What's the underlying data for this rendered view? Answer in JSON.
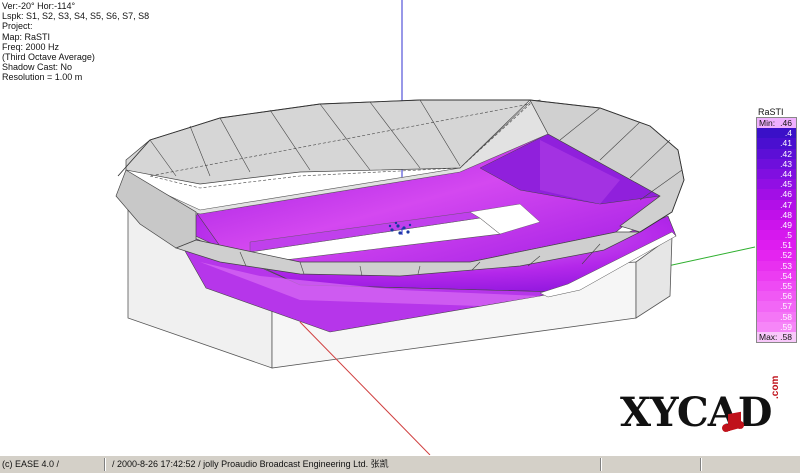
{
  "info": {
    "lines": [
      "Ver:-20°  Hor:-114°",
      "Lspk: S1, S2, S3, S4, S5, S6, S7, S8",
      "Project:",
      "Map: RaSTI",
      "Freq: 2000 Hz",
      "(Third Octave Average)",
      "Shadow Cast: No",
      "Resolution =  1.00 m"
    ]
  },
  "legend": {
    "title": "RaSTI",
    "rows": [
      {
        "label": "Min:",
        "value": ".46",
        "color": "#f0b0ff",
        "text_color": "#111111"
      },
      {
        "label": "",
        "value": ".4",
        "color": "#3a10c8",
        "text_color": "#ffffff"
      },
      {
        "label": "",
        "value": ".41",
        "color": "#4a0fd0",
        "text_color": "#ffffff"
      },
      {
        "label": "",
        "value": ".42",
        "color": "#5c0fd6",
        "text_color": "#ffffff"
      },
      {
        "label": "",
        "value": ".43",
        "color": "#6e0fdc",
        "text_color": "#ffffff"
      },
      {
        "label": "",
        "value": ".44",
        "color": "#800fe0",
        "text_color": "#ffffff"
      },
      {
        "label": "",
        "value": ".45",
        "color": "#910fe4",
        "text_color": "#ffffff"
      },
      {
        "label": "",
        "value": ".46",
        "color": "#a20fe6",
        "text_color": "#ffffff"
      },
      {
        "label": "",
        "value": ".47",
        "color": "#b20fe8",
        "text_color": "#ffffff"
      },
      {
        "label": "",
        "value": ".48",
        "color": "#c010ea",
        "text_color": "#ffffff"
      },
      {
        "label": "",
        "value": ".49",
        "color": "#cc14ec",
        "text_color": "#ffffff"
      },
      {
        "label": "",
        "value": ".5",
        "color": "#d618ee",
        "text_color": "#ffffff"
      },
      {
        "label": "",
        "value": ".51",
        "color": "#de1cf0",
        "text_color": "#ffffff"
      },
      {
        "label": "",
        "value": ".52",
        "color": "#e424f0",
        "text_color": "#ffffff"
      },
      {
        "label": "",
        "value": ".53",
        "color": "#e830f0",
        "text_color": "#ffffff"
      },
      {
        "label": "",
        "value": ".54",
        "color": "#ec3cf2",
        "text_color": "#ffffff"
      },
      {
        "label": "",
        "value": ".55",
        "color": "#ee4af4",
        "text_color": "#ffffff"
      },
      {
        "label": "",
        "value": ".56",
        "color": "#f058f4",
        "text_color": "#ffffff"
      },
      {
        "label": "",
        "value": ".57",
        "color": "#f266f6",
        "text_color": "#ffffff"
      },
      {
        "label": "",
        "value": ".58",
        "color": "#f476f6",
        "text_color": "#ffffff"
      },
      {
        "label": "",
        "value": ".59",
        "color": "#f686f8",
        "text_color": "#ffffff"
      },
      {
        "label": "Max:",
        "value": ".58",
        "color": "#f8c8fa",
        "text_color": "#111111"
      }
    ]
  },
  "logo": {
    "text": "XYCAD",
    "sub": ".com"
  },
  "statusbar": {
    "cells": [
      "(c) EASE 4.0  /",
      "/ 2000-8-26 17:42:52 / jolly Proaudio Broadcast Engineering Ltd. 张凯"
    ]
  },
  "colors": {
    "floor": "#b020e8",
    "floor_light": "#e070f0",
    "roof": "#d8d8d8",
    "wall": "#f2f2f2",
    "axis_x": "#d04040",
    "axis_y": "#30b030",
    "axis_z": "#3030d0"
  }
}
